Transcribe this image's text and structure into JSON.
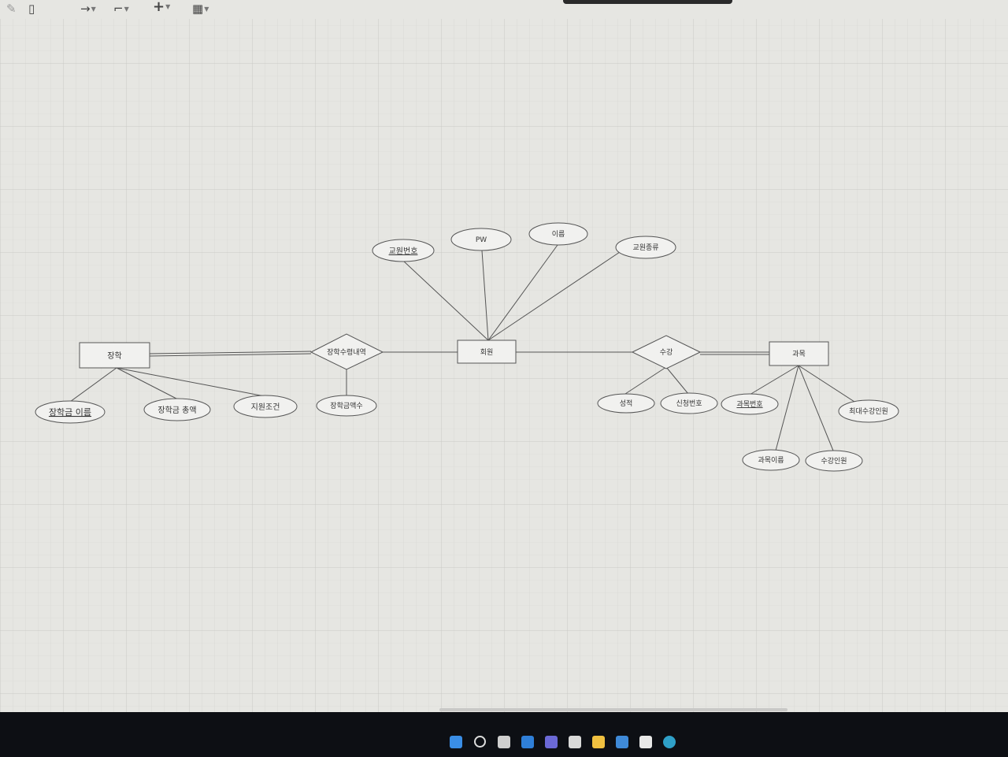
{
  "toolbar": {
    "tools": [
      {
        "name": "edit-icon",
        "glyph": "✎"
      },
      {
        "name": "delete-icon",
        "glyph": "▯"
      },
      {
        "name": "connector-icon",
        "glyph": "→"
      },
      {
        "name": "waypoint-icon",
        "glyph": "⌐"
      },
      {
        "name": "insert-icon",
        "glyph": "+"
      },
      {
        "name": "table-icon",
        "glyph": "▦"
      }
    ]
  },
  "diagram": {
    "entities": {
      "scholarship": "장학",
      "member": "회원",
      "course": "과목"
    },
    "relationships": {
      "scholarship_receipt": "장학수령내역",
      "enrollment": "수강"
    },
    "attributes": {
      "scholarship_name": "장학금 이름",
      "scholarship_total": "장학금 총액",
      "support_condition": "지원조건",
      "scholarship_amount": "장학금액수",
      "member_no": "교원번호",
      "pw": "PW",
      "name": "이름",
      "member_type": "교원종류",
      "grade": "성적",
      "application_no": "신청번호",
      "course_no": "과목번호",
      "max_students": "최대수강인원",
      "course_name": "과목이름",
      "enrolled_count": "수강인원"
    }
  },
  "taskbar": {
    "icons": [
      "windows-start-icon",
      "search-icon",
      "task-view-icon",
      "widgets-icon",
      "chat-icon",
      "store-icon",
      "file-explorer-icon",
      "mail-icon",
      "app-icon",
      "edge-icon"
    ]
  }
}
